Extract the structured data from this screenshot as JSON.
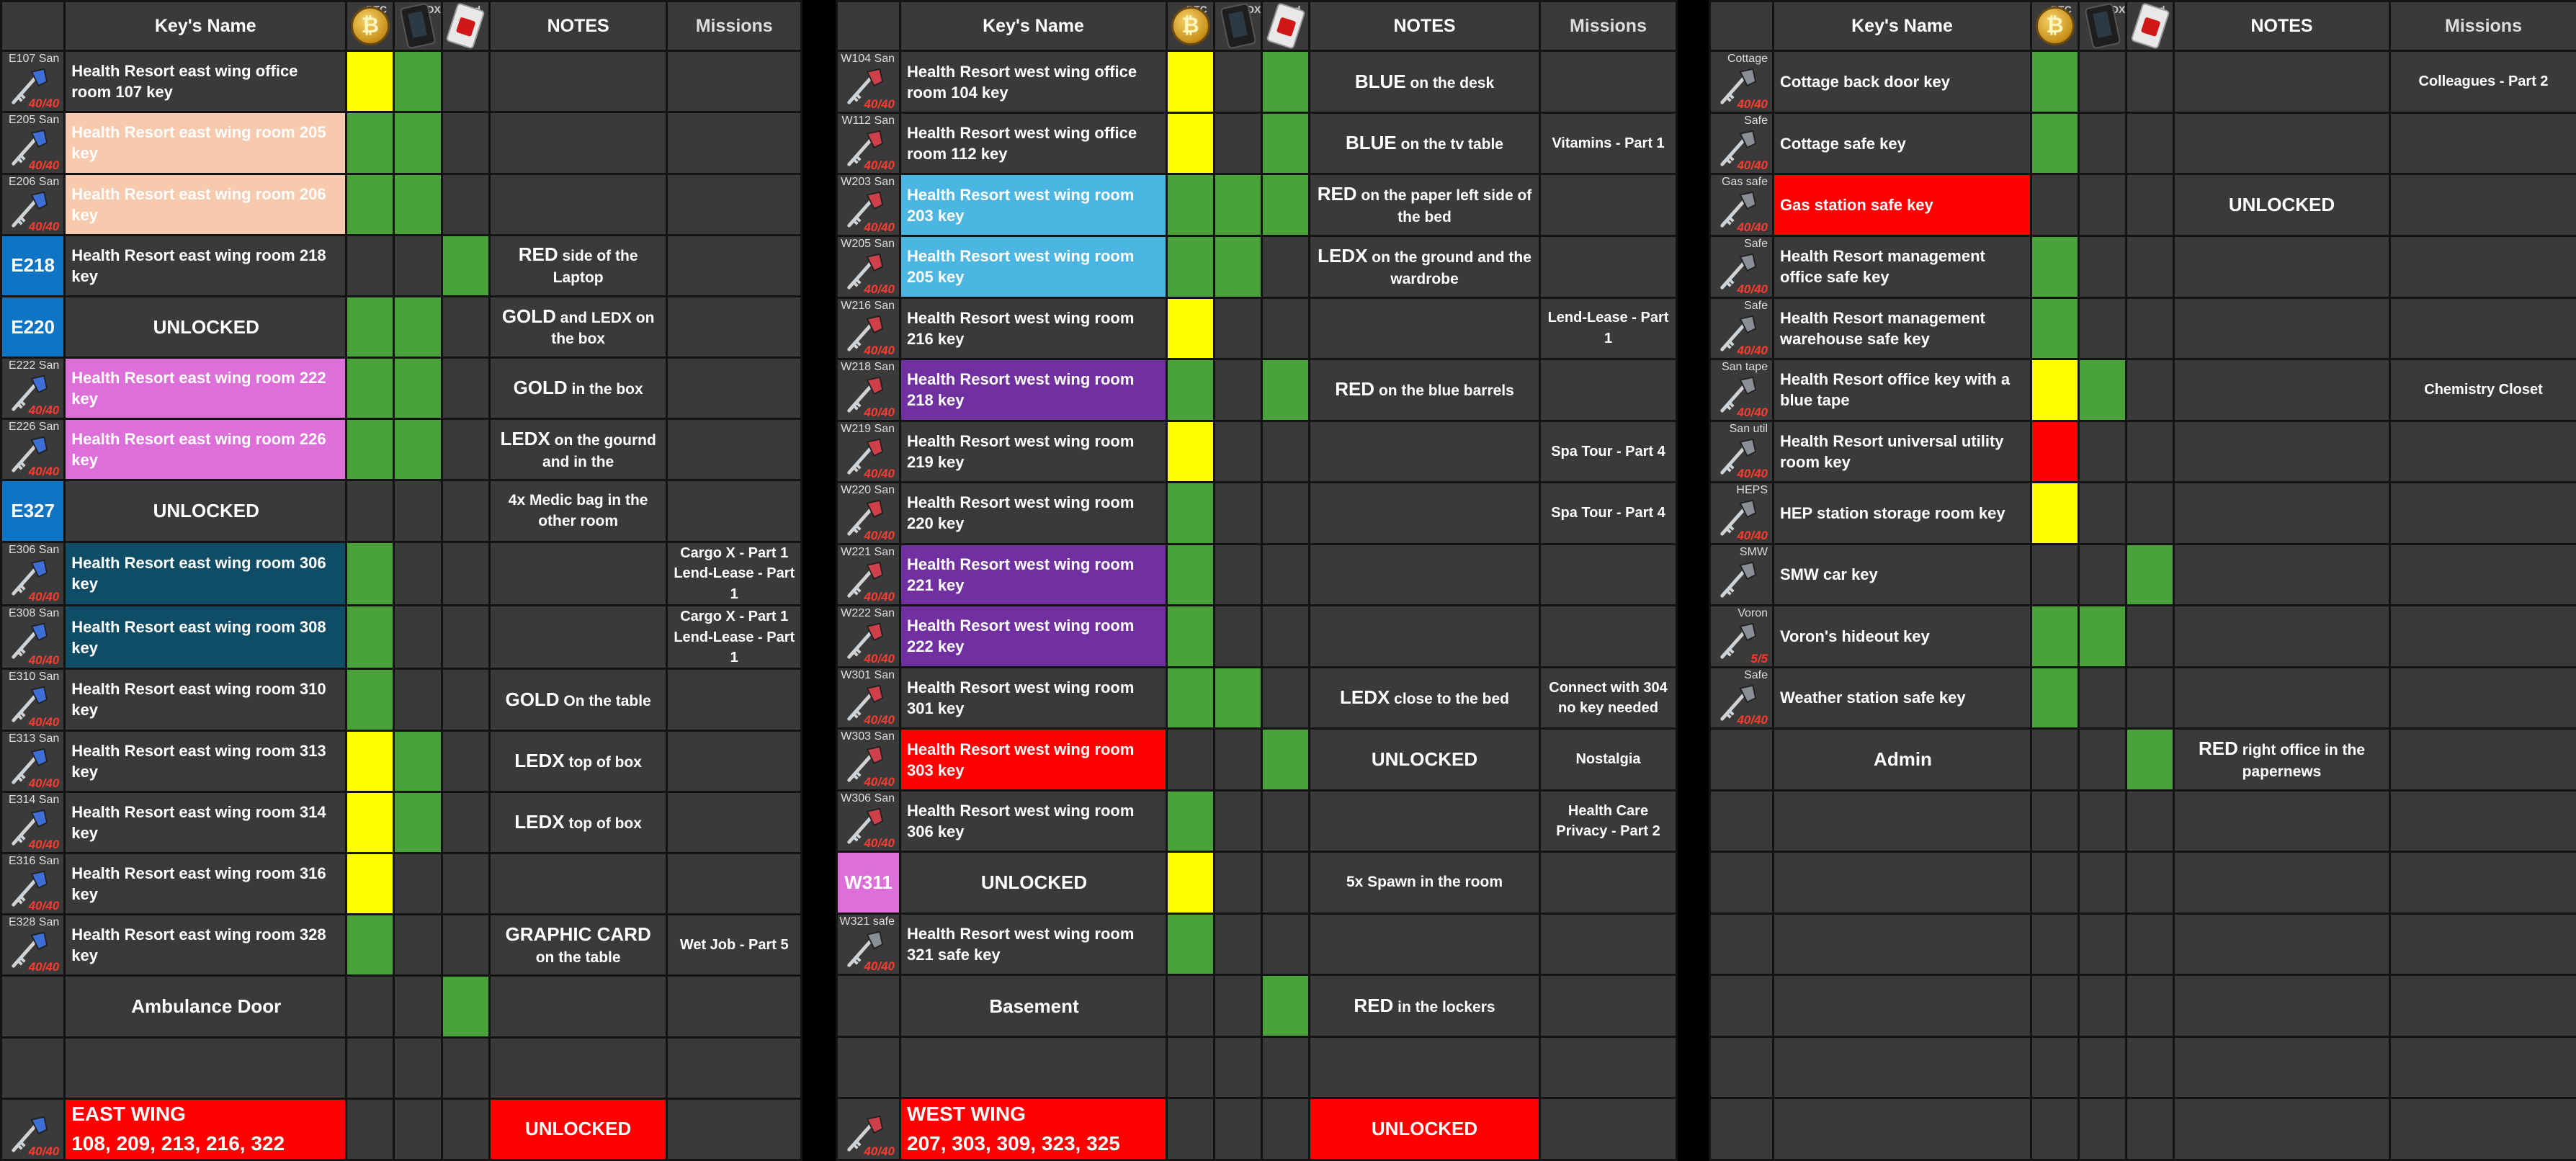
{
  "headers": {
    "key_name": "Key's Name",
    "notes": "NOTES",
    "missions": "Missions",
    "icon_labels": [
      "BTC",
      "LEDX",
      "Red"
    ]
  },
  "colors": {
    "green": "#4aa33a",
    "yellow": "#ffff00",
    "red": "#ff0000",
    "peach": "#f7c9ad",
    "cyan": "#4cb6e2",
    "pink": "#dd6fd9",
    "purple": "#7130a0",
    "teal": "#0f4d66",
    "blue_code": "#0f74c4",
    "cell": "#3a3a3a"
  },
  "panels": [
    {
      "id": "east",
      "rows": [
        {
          "tag": "E107 San",
          "dur": "40/40",
          "name": "Health Resort east wing office room 107 key",
          "name_bg": null,
          "icon": "key-icon-blue",
          "c1": "yellow",
          "c2": "green",
          "c3": null,
          "notes_b": "",
          "notes": "",
          "missions": ""
        },
        {
          "tag": "E205 San",
          "dur": "40/40",
          "name": "Health Resort east wing room 205 key",
          "name_bg": "peach",
          "icon": "key-icon-blue",
          "c1": "green",
          "c2": "green",
          "c3": null,
          "notes_b": "",
          "notes": "",
          "missions": ""
        },
        {
          "tag": "E206 San",
          "dur": "40/40",
          "name": "Health Resort east wing room 206 key",
          "name_bg": "peach",
          "icon": "key-icon-blue",
          "c1": "green",
          "c2": "green",
          "c3": null,
          "notes_b": "",
          "notes": "",
          "missions": ""
        },
        {
          "code": "E218",
          "name": "Health Resort east wing room 218 key",
          "name_bg": null,
          "c1": null,
          "c2": null,
          "c3": "green",
          "notes_b": "RED",
          "notes": "side of the Laptop",
          "missions": ""
        },
        {
          "code": "E220",
          "name": "UNLOCKED",
          "name_center": true,
          "name_bg": null,
          "c1": "green",
          "c2": "green",
          "c3": null,
          "notes_b": "GOLD",
          "notes": "and LEDX on the box",
          "missions": ""
        },
        {
          "tag": "E222 San",
          "dur": "40/40",
          "name": "Health Resort east wing room 222 key",
          "name_bg": "pink",
          "icon": "key-icon-blue",
          "c1": "green",
          "c2": "green",
          "c3": null,
          "notes_b": "GOLD",
          "notes": "in the box",
          "missions": ""
        },
        {
          "tag": "E226 San",
          "dur": "40/40",
          "name": "Health Resort east wing room 226 key",
          "name_bg": "pink",
          "icon": "key-icon-blue",
          "c1": "green",
          "c2": "green",
          "c3": null,
          "notes_b": "LEDX",
          "notes": "on the gournd and in the",
          "missions": ""
        },
        {
          "code": "E327",
          "name": "UNLOCKED",
          "name_center": true,
          "name_bg": null,
          "c1": null,
          "c2": null,
          "c3": null,
          "notes_b": "",
          "notes": "4x Medic bag in the other room",
          "missions": ""
        },
        {
          "tag": "E306 San",
          "dur": "40/40",
          "name": "Health Resort east wing room 306 key",
          "name_bg": "teal",
          "icon": "key-icon-blue",
          "c1": "green",
          "c2": null,
          "c3": null,
          "notes_b": "",
          "notes": "",
          "missions": "Cargo X - Part 1\nLend-Lease - Part 1"
        },
        {
          "tag": "E308 San",
          "dur": "40/40",
          "name": "Health Resort east wing room 308 key",
          "name_bg": "teal",
          "icon": "key-icon-blue",
          "c1": "green",
          "c2": null,
          "c3": null,
          "notes_b": "",
          "notes": "",
          "missions": "Cargo X - Part 1\nLend-Lease - Part 1"
        },
        {
          "tag": "E310 San",
          "dur": "40/40",
          "name": "Health Resort east wing room 310 key",
          "name_bg": null,
          "icon": "key-icon-blue",
          "c1": "green",
          "c2": null,
          "c3": null,
          "notes_b": "GOLD",
          "notes": "On the table",
          "missions": ""
        },
        {
          "tag": "E313 San",
          "dur": "40/40",
          "name": "Health Resort east wing room 313 key",
          "name_bg": null,
          "icon": "key-icon-blue",
          "c1": "yellow",
          "c2": "green",
          "c3": null,
          "notes_b": "LEDX",
          "notes": "top of box",
          "missions": ""
        },
        {
          "tag": "E314 San",
          "dur": "40/40",
          "name": "Health Resort east wing room 314 key",
          "name_bg": null,
          "icon": "key-icon-blue",
          "c1": "yellow",
          "c2": "green",
          "c3": null,
          "notes_b": "LEDX",
          "notes": "top of box",
          "missions": ""
        },
        {
          "tag": "E316 San",
          "dur": "40/40",
          "name": "Health Resort east wing room 316 key",
          "name_bg": null,
          "icon": "key-icon-blue",
          "c1": "yellow",
          "c2": null,
          "c3": null,
          "notes_b": "",
          "notes": "",
          "missions": ""
        },
        {
          "tag": "E328 San",
          "dur": "40/40",
          "name": "Health Resort east wing room 328 key",
          "name_bg": null,
          "icon": "key-icon-blue",
          "c1": "green",
          "c2": null,
          "c3": null,
          "notes_b": "GRAPHIC CARD",
          "notes": "on the table",
          "missions": "Wet Job - Part 5"
        },
        {
          "blank_icon": true,
          "name": "Ambulance Door",
          "name_center": true,
          "name_bg": null,
          "c1": null,
          "c2": null,
          "c3": "green",
          "notes_b": "",
          "notes": "",
          "missions": ""
        },
        {
          "blank_icon": true,
          "name": "",
          "name_bg": null,
          "c1": null,
          "c2": null,
          "c3": null,
          "notes_b": "",
          "notes": "",
          "missions": ""
        }
      ],
      "footer": {
        "dur": "40/40",
        "icon": "key-icon-blue",
        "title": "EAST WING",
        "rooms": "108, 209, 213, 216, 322",
        "notes": "UNLOCKED"
      }
    },
    {
      "id": "west",
      "rows": [
        {
          "tag": "W104 San",
          "dur": "40/40",
          "name": "Health Resort west wing office room 104 key",
          "name_bg": null,
          "icon": "key-icon-red",
          "c1": "yellow",
          "c2": null,
          "c3": "green",
          "notes_b": "BLUE",
          "notes": "on the desk",
          "missions": ""
        },
        {
          "tag": "W112 San",
          "dur": "40/40",
          "name": "Health Resort west wing office room 112 key",
          "name_bg": null,
          "icon": "key-icon-red",
          "c1": "yellow",
          "c2": null,
          "c3": "green",
          "notes_b": "BLUE",
          "notes": "on the tv table",
          "missions": "Vitamins - Part 1"
        },
        {
          "tag": "W203 San",
          "dur": "40/40",
          "name": "Health Resort west wing room 203 key",
          "name_bg": "cyan",
          "icon": "key-icon-red",
          "c1": "green",
          "c2": "green",
          "c3": "green",
          "notes_b": "RED",
          "notes": "on the paper left side of the bed",
          "missions": ""
        },
        {
          "tag": "W205 San",
          "dur": "40/40",
          "name": "Health Resort west wing room 205 key",
          "name_bg": "cyan",
          "icon": "key-icon-red",
          "c1": "green",
          "c2": "green",
          "c3": null,
          "notes_b": "LEDX",
          "notes": "on the ground and the wardrobe",
          "missions": ""
        },
        {
          "tag": "W216 San",
          "dur": "40/40",
          "name": "Health Resort west wing room 216 key",
          "name_bg": null,
          "icon": "key-icon-red",
          "c1": "yellow",
          "c2": null,
          "c3": null,
          "notes_b": "",
          "notes": "",
          "missions": "Lend-Lease - Part 1"
        },
        {
          "tag": "W218 San",
          "dur": "40/40",
          "name": "Health Resort west wing room 218 key",
          "name_bg": "purple",
          "icon": "key-icon-red",
          "c1": "green",
          "c2": null,
          "c3": "green",
          "notes_b": "RED",
          "notes": "on the blue barrels",
          "missions": ""
        },
        {
          "tag": "W219 San",
          "dur": "40/40",
          "name": "Health Resort west wing room 219 key",
          "name_bg": null,
          "icon": "key-icon-red",
          "c1": "yellow",
          "c2": null,
          "c3": null,
          "notes_b": "",
          "notes": "",
          "missions": "Spa Tour - Part 4"
        },
        {
          "tag": "W220 San",
          "dur": "40/40",
          "name": "Health Resort west wing room 220 key",
          "name_bg": null,
          "icon": "key-icon-red",
          "c1": "green",
          "c2": null,
          "c3": null,
          "notes_b": "",
          "notes": "",
          "missions": "Spa Tour - Part 4"
        },
        {
          "tag": "W221 San",
          "dur": "40/40",
          "name": "Health Resort west wing room 221 key",
          "name_bg": "purple",
          "icon": "key-icon-red",
          "c1": "green",
          "c2": null,
          "c3": null,
          "notes_b": "",
          "notes": "",
          "missions": ""
        },
        {
          "tag": "W222 San",
          "dur": "40/40",
          "name": "Health Resort west wing room 222 key",
          "name_bg": "purple",
          "icon": "key-icon-red",
          "c1": "green",
          "c2": null,
          "c3": null,
          "notes_b": "",
          "notes": "",
          "missions": ""
        },
        {
          "tag": "W301 San",
          "dur": "40/40",
          "name": "Health Resort west wing room 301 key",
          "name_bg": null,
          "icon": "key-icon-red",
          "c1": "green",
          "c2": "green",
          "c3": null,
          "notes_b": "LEDX",
          "notes": "close to the bed",
          "missions": "Connect with 304\nno key needed"
        },
        {
          "tag": "W303 San",
          "dur": "40/40",
          "name": "Health Resort west wing room 303 key",
          "name_bg": "red",
          "icon": "key-icon-red",
          "c1": null,
          "c2": null,
          "c3": "green",
          "notes_b": "",
          "notes": "UNLOCKED",
          "notes_big": true,
          "missions": "Nostalgia"
        },
        {
          "tag": "W306 San",
          "dur": "40/40",
          "name": "Health Resort west wing room 306 key",
          "name_bg": null,
          "icon": "key-icon-red",
          "c1": "green",
          "c2": null,
          "c3": null,
          "notes_b": "",
          "notes": "",
          "missions": "Health Care\nPrivacy - Part 2"
        },
        {
          "code": "W311",
          "code_bg": "pink",
          "name": "UNLOCKED",
          "name_center": true,
          "name_bg": null,
          "c1": "yellow",
          "c2": null,
          "c3": null,
          "notes_b": "",
          "notes": "5x Spawn in the room",
          "missions": ""
        },
        {
          "tag": "W321 safe",
          "dur": "40/40",
          "name": "Health Resort west wing room 321 safe key",
          "name_bg": null,
          "icon": "key-icon-gray",
          "c1": "green",
          "c2": null,
          "c3": null,
          "notes_b": "",
          "notes": "",
          "missions": ""
        },
        {
          "blank_icon": true,
          "name": "Basement",
          "name_center": true,
          "name_bg": null,
          "c1": null,
          "c2": null,
          "c3": "green",
          "notes_b": "RED",
          "notes": "in the lockers",
          "missions": ""
        },
        {
          "blank_icon": true,
          "name": "",
          "name_bg": null,
          "c1": null,
          "c2": null,
          "c3": null,
          "notes_b": "",
          "notes": "",
          "missions": ""
        }
      ],
      "footer": {
        "dur": "40/40",
        "icon": "key-icon-red",
        "title": "WEST WING",
        "rooms": "207, 303, 309, 323, 325",
        "notes": "UNLOCKED"
      }
    },
    {
      "id": "locations",
      "rows": [
        {
          "tag": "Cottage",
          "dur": "40/40",
          "name": "Cottage back door key",
          "name_bg": null,
          "icon": "key-icon-gray",
          "c1": "green",
          "c2": null,
          "c3": null,
          "notes_b": "",
          "notes": "",
          "missions": "Colleagues - Part 2"
        },
        {
          "tag": "Safe",
          "dur": "40/40",
          "name": "Cottage safe key",
          "name_bg": null,
          "icon": "key-icon-gray",
          "c1": "green",
          "c2": null,
          "c3": null,
          "notes_b": "",
          "notes": "",
          "missions": ""
        },
        {
          "tag": "Gas safe",
          "dur": "40/40",
          "name": "Gas station safe key",
          "name_bg": "red",
          "icon": "key-icon-gray",
          "c1": null,
          "c2": null,
          "c3": null,
          "notes_b": "",
          "notes": "UNLOCKED",
          "notes_big": true,
          "missions": ""
        },
        {
          "tag": "Safe",
          "dur": "40/40",
          "name": "Health Resort management office safe key",
          "name_bg": null,
          "icon": "key-icon-gray",
          "c1": "green",
          "c2": null,
          "c3": null,
          "notes_b": "",
          "notes": "",
          "missions": ""
        },
        {
          "tag": "Safe",
          "dur": "40/40",
          "name": "Health Resort management warehouse safe key",
          "name_bg": null,
          "icon": "key-icon-gray",
          "c1": "green",
          "c2": null,
          "c3": null,
          "notes_b": "",
          "notes": "",
          "missions": ""
        },
        {
          "tag": "San tape",
          "dur": "40/40",
          "name": "Health Resort office key with a blue tape",
          "name_bg": null,
          "icon": "key-icon-gray",
          "c1": "yellow",
          "c2": "green",
          "c3": null,
          "notes_b": "",
          "notes": "",
          "missions": "Chemistry Closet"
        },
        {
          "tag": "San util",
          "dur": "40/40",
          "name": "Health Resort universal utility room key",
          "name_bg": null,
          "icon": "key-icon-gray",
          "c1": "red",
          "c2": null,
          "c3": null,
          "notes_b": "",
          "notes": "",
          "missions": ""
        },
        {
          "tag": "HEPS",
          "dur": "40/40",
          "name": "HEP station storage room key",
          "name_bg": null,
          "icon": "key-icon-gray",
          "c1": "yellow",
          "c2": null,
          "c3": null,
          "notes_b": "",
          "notes": "",
          "missions": ""
        },
        {
          "tag": "SMW",
          "dur": "",
          "name": "SMW car key",
          "name_bg": null,
          "icon": "key-icon-gray",
          "c1": null,
          "c2": null,
          "c3": "green",
          "notes_b": "",
          "notes": "",
          "missions": ""
        },
        {
          "tag": "Voron",
          "dur": "5/5",
          "name": "Voron's hideout key",
          "name_bg": null,
          "icon": "key-icon-gray",
          "c1": "green",
          "c2": "green",
          "c3": null,
          "notes_b": "",
          "notes": "",
          "missions": ""
        },
        {
          "tag": "Safe",
          "dur": "40/40",
          "name": "Weather station safe key",
          "name_bg": null,
          "icon": "key-icon-gray",
          "c1": "green",
          "c2": null,
          "c3": null,
          "notes_b": "",
          "notes": "",
          "missions": ""
        },
        {
          "blank_icon": true,
          "name": "Admin",
          "name_center": true,
          "name_bg": null,
          "c1": null,
          "c2": null,
          "c3": "green",
          "notes_b": "RED",
          "notes": "right office in the papernews",
          "missions": ""
        },
        {
          "blank_icon": true,
          "name": "",
          "c1": null,
          "c2": null,
          "c3": null,
          "notes_b": "",
          "notes": "",
          "missions": ""
        },
        {
          "blank_icon": true,
          "name": "",
          "c1": null,
          "c2": null,
          "c3": null,
          "notes_b": "",
          "notes": "",
          "missions": ""
        },
        {
          "blank_icon": true,
          "name": "",
          "c1": null,
          "c2": null,
          "c3": null,
          "notes_b": "",
          "notes": "",
          "missions": ""
        },
        {
          "blank_icon": true,
          "name": "",
          "c1": null,
          "c2": null,
          "c3": null,
          "notes_b": "",
          "notes": "",
          "missions": ""
        },
        {
          "blank_icon": true,
          "name": "",
          "c1": null,
          "c2": null,
          "c3": null,
          "notes_b": "",
          "notes": "",
          "missions": ""
        }
      ],
      "footer": null
    }
  ]
}
